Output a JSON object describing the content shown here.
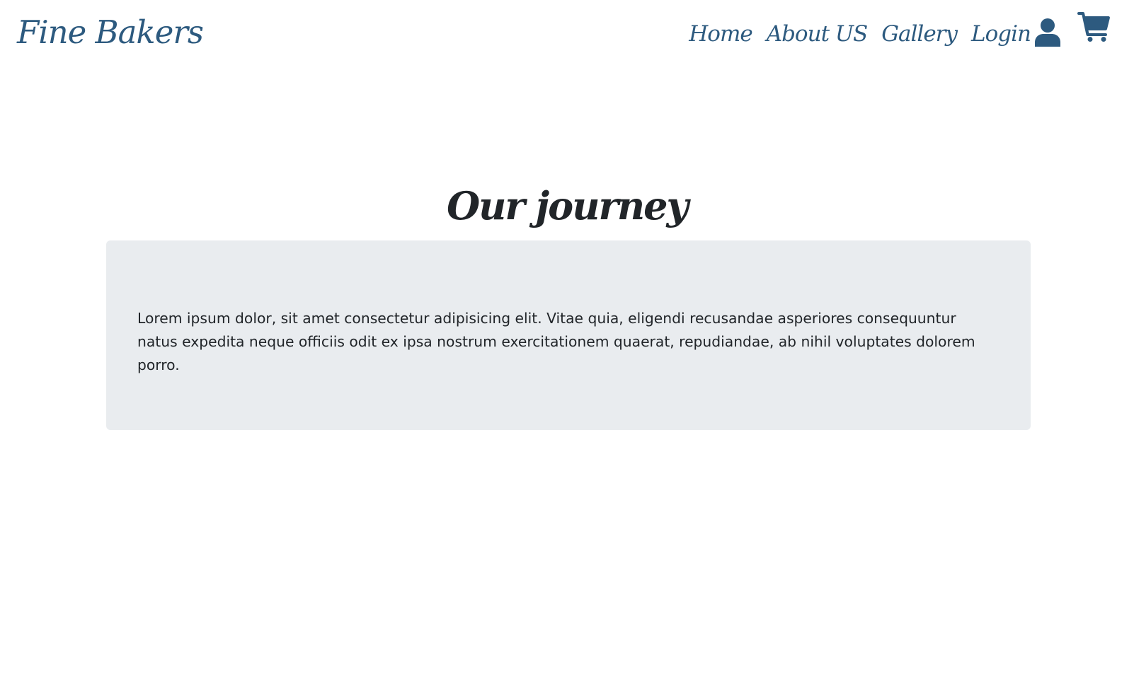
{
  "navbar": {
    "brand": "Fine Bakers",
    "links": [
      {
        "label": "Home"
      },
      {
        "label": "About US"
      },
      {
        "label": "Gallery"
      },
      {
        "label": "Login"
      }
    ],
    "icons": {
      "user": "user-icon",
      "cart": "shopping-cart-icon"
    }
  },
  "main": {
    "title": "Our journey",
    "paragraph": "Lorem ipsum dolor, sit amet consectetur adipisicing elit. Vitae quia, eligendi recusandae asperiores consequuntur natus expedita neque officiis odit ex ipsa nostrum exercitationem quaerat, repudiandae, ab nihil voluptates dolorem porro."
  },
  "colors": {
    "brand": "#2d5a7f",
    "text": "#212529",
    "panel": "#e9ecef",
    "background": "#ffffff"
  }
}
